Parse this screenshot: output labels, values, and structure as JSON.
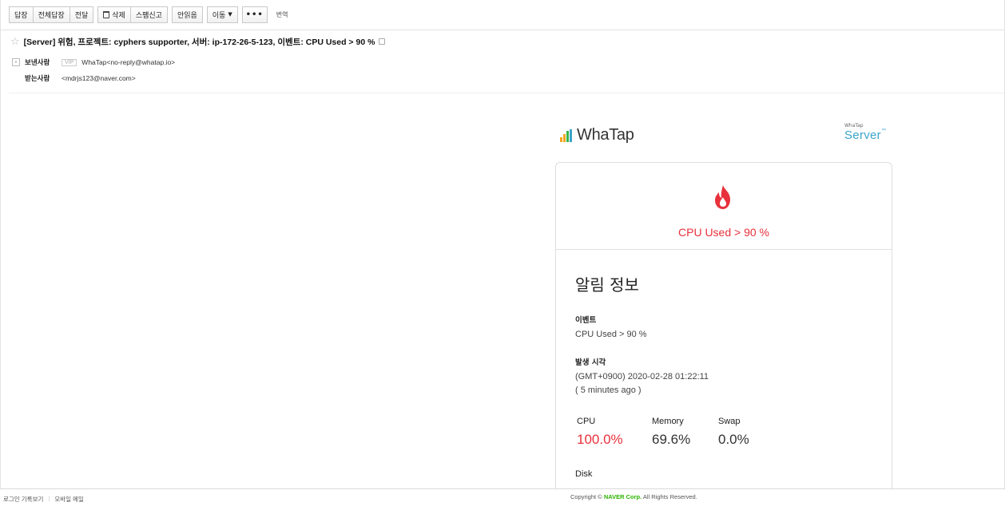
{
  "toolbar": {
    "reply": "답장",
    "reply_all": "전체답장",
    "forward": "전달",
    "delete": "삭제",
    "spam": "스팸신고",
    "unread": "안읽음",
    "move": "이동",
    "more": "•••",
    "translate": "번역"
  },
  "message": {
    "subject": "[Server] 위험, 프로젝트: cyphers supporter, 서버: ip-172-26-5-123, 이벤트: CPU Used > 90 %",
    "sender_label": "보낸사람",
    "vip": "VIP",
    "sender": "WhaTap<no-reply@whatap.io>",
    "recipient_label": "받는사람",
    "recipient": "<mdrjs123@naver.com>"
  },
  "email": {
    "brand": "WhaTap",
    "product_small": "WhaTap",
    "product": "Server",
    "product_tm": "™",
    "alert_title": "CPU Used > 90 %",
    "section_title": "알림 정보",
    "event_label": "이벤트",
    "event_value": "CPU Used > 90 %",
    "time_label": "발생 시각",
    "time_value": "(GMT+0900) 2020-02-28 01:22:11",
    "time_ago": "( 5 minutes ago )",
    "metrics": [
      {
        "label": "CPU",
        "value": "100.0%"
      },
      {
        "label": "Memory",
        "value": "69.6%"
      },
      {
        "label": "Swap",
        "value": "0.0%"
      }
    ],
    "disk_label": "Disk",
    "colors": {
      "alert": "#e8313b",
      "product": "#3aa4c9",
      "bars": [
        "#f5a623",
        "#f5a623",
        "#39b54a",
        "#3aa4c9"
      ]
    }
  },
  "footer": {
    "login_history": "로그인 기록보기",
    "mobile_mail": "모바일 메일",
    "copyright_prefix": "Copyright ©",
    "corp": "NAVER Corp.",
    "rights": "All Rights Reserved."
  }
}
